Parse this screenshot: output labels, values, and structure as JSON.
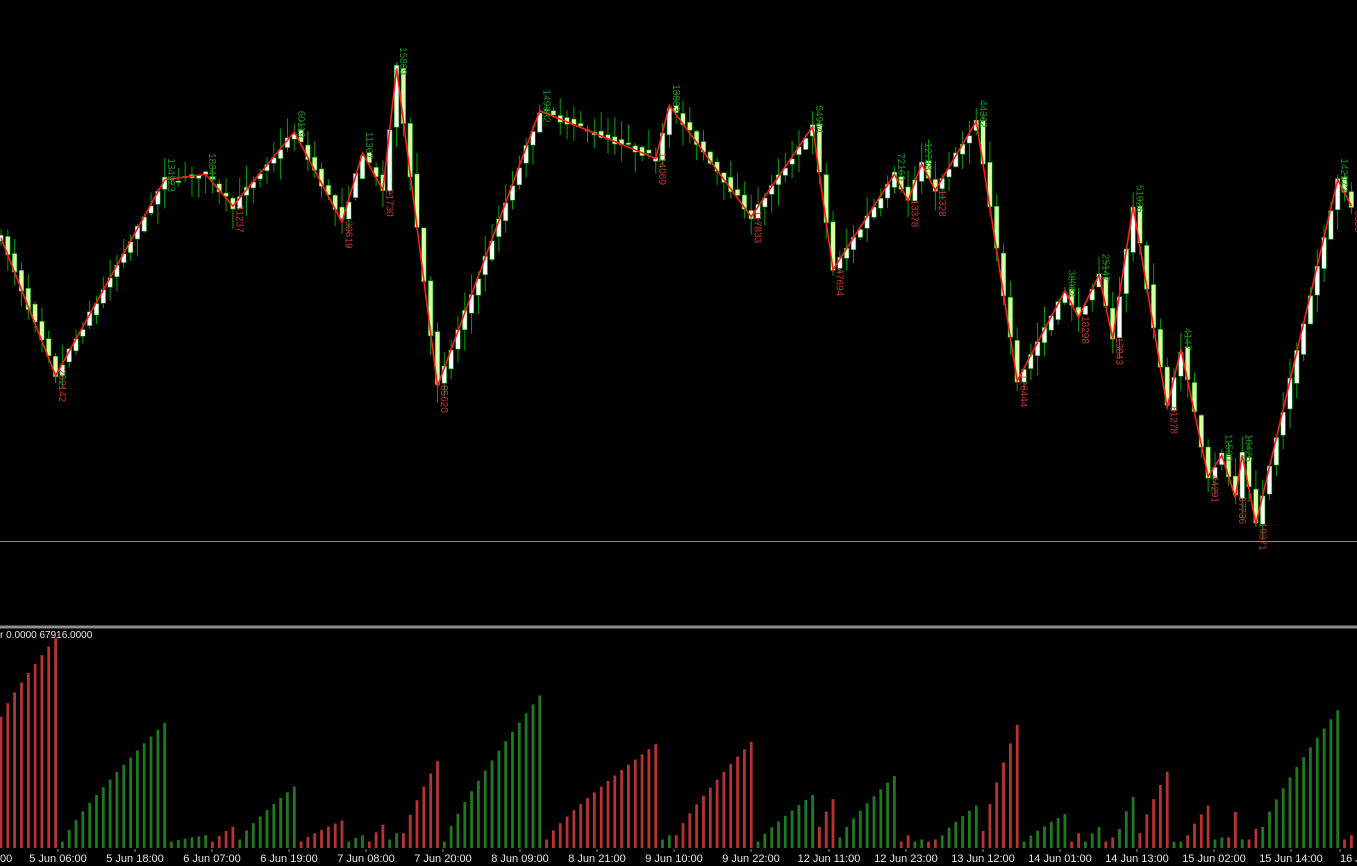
{
  "indicator": {
    "label": "r 0.0000 67916.0000"
  },
  "colors": {
    "background": "#000000",
    "wick": "#00a000",
    "bull_body": "#ffffff",
    "bear_body": "#d8ffa0",
    "zigzag": "#ff1a1a",
    "label_up": "#1f8f1f",
    "label_down": "#c83232",
    "hist_up": "#1e7a1e",
    "hist_down": "#b83232",
    "separator": "#8c8c8c",
    "time_text": "#e6e6e6"
  },
  "chart_data": [
    {
      "type": "candlestick",
      "subtype": "price with zigzag swing volume labels",
      "time_labels": [
        "00",
        "5 Jun 06:00",
        "5 Jun 18:00",
        "6 Jun 07:00",
        "6 Jun 19:00",
        "7 Jun 08:00",
        "7 Jun 20:00",
        "8 Jun 09:00",
        "8 Jun 21:00",
        "9 Jun 10:00",
        "9 Jun 22:00",
        "12 Jun 11:00",
        "12 Jun 23:00",
        "13 Jun 12:00",
        "14 Jun 01:00",
        "14 Jun 13:00",
        "15 Jun 02:00",
        "15 Jun 14:00",
        "16 J"
      ],
      "zigzag": [
        {
          "i": 0,
          "y": 57,
          "label": ""
        },
        {
          "i": 8,
          "y": 31,
          "label": "202142",
          "dir": "down"
        },
        {
          "i": 24,
          "y": 68,
          "label": "134923",
          "dir": "up"
        },
        {
          "i": 30,
          "y": 69,
          "label": "18348",
          "dir": "up"
        },
        {
          "i": 34,
          "y": 63,
          "label": "31237",
          "dir": "down"
        },
        {
          "i": 43,
          "y": 77,
          "label": "60119",
          "dir": "up"
        },
        {
          "i": 50,
          "y": 60,
          "label": "30619",
          "dir": "down"
        },
        {
          "i": 53,
          "y": 73,
          "label": "11307",
          "dir": "up"
        },
        {
          "i": 56,
          "y": 66,
          "label": "21730",
          "dir": "down"
        },
        {
          "i": 58,
          "y": 89,
          "label": "15889",
          "dir": "up"
        },
        {
          "i": 64,
          "y": 29,
          "label": "85620",
          "dir": "down"
        },
        {
          "i": 79,
          "y": 81,
          "label": "149382",
          "dir": "up"
        },
        {
          "i": 96,
          "y": 72,
          "label": "114069",
          "dir": "down"
        },
        {
          "i": 98,
          "y": 82,
          "label": "13883",
          "dir": "up"
        },
        {
          "i": 110,
          "y": 61,
          "label": "117833",
          "dir": "down"
        },
        {
          "i": 119,
          "y": 78,
          "label": "54964",
          "dir": "up"
        },
        {
          "i": 122,
          "y": 51,
          "label": "47694",
          "dir": "down"
        },
        {
          "i": 131,
          "y": 69,
          "label": "72160",
          "dir": "up"
        },
        {
          "i": 133,
          "y": 64,
          "label": "13378",
          "dir": "down"
        },
        {
          "i": 135,
          "y": 71,
          "label": "12738",
          "dir": "up"
        },
        {
          "i": 137,
          "y": 66,
          "label": "11328",
          "dir": "down"
        },
        {
          "i": 143,
          "y": 79,
          "label": "44362",
          "dir": "up"
        },
        {
          "i": 149,
          "y": 30,
          "label": "126444",
          "dir": "down"
        },
        {
          "i": 156,
          "y": 47,
          "label": "38084",
          "dir": "up"
        },
        {
          "i": 158,
          "y": 42,
          "label": "18298",
          "dir": "down"
        },
        {
          "i": 161,
          "y": 50,
          "label": "25147",
          "dir": "up"
        },
        {
          "i": 163,
          "y": 38,
          "label": "13843",
          "dir": "down"
        },
        {
          "i": 166,
          "y": 63,
          "label": "51026",
          "dir": "up"
        },
        {
          "i": 171,
          "y": 25,
          "label": "81278",
          "dir": "down"
        },
        {
          "i": 173,
          "y": 36,
          "label": "4147",
          "dir": "up"
        },
        {
          "i": 177,
          "y": 12,
          "label": "44291",
          "dir": "down"
        },
        {
          "i": 179,
          "y": 16,
          "label": "11560",
          "dir": "up"
        },
        {
          "i": 181,
          "y": 8,
          "label": "37736",
          "dir": "down"
        },
        {
          "i": 182,
          "y": 16,
          "label": "10426",
          "dir": "up"
        },
        {
          "i": 184,
          "y": 3,
          "label": "19371",
          "dir": "down"
        },
        {
          "i": 196,
          "y": 68,
          "label": "142972",
          "dir": "up"
        },
        {
          "i": 198,
          "y": 63,
          "label": "6380",
          "dir": "down"
        }
      ]
    },
    {
      "type": "bar",
      "subtype": "cumulative swing volume histogram",
      "ylim": [
        0,
        67916
      ],
      "segments": [
        {
          "dir": "down",
          "start": 0,
          "end": 8,
          "from": 0.62,
          "to": 0.99
        },
        {
          "dir": "up",
          "start": 9,
          "end": 24,
          "from": 0.03,
          "to": 0.59
        },
        {
          "dir": "up",
          "start": 25,
          "end": 30,
          "from": 0.03,
          "to": 0.06
        },
        {
          "dir": "down",
          "start": 31,
          "end": 34,
          "from": 0.03,
          "to": 0.1
        },
        {
          "dir": "up",
          "start": 35,
          "end": 43,
          "from": 0.04,
          "to": 0.29
        },
        {
          "dir": "down",
          "start": 44,
          "end": 50,
          "from": 0.03,
          "to": 0.13
        },
        {
          "dir": "up",
          "start": 51,
          "end": 53,
          "from": 0.03,
          "to": 0.06
        },
        {
          "dir": "down",
          "start": 54,
          "end": 56,
          "from": 0.03,
          "to": 0.11
        },
        {
          "dir": "up",
          "start": 57,
          "end": 58,
          "from": 0.04,
          "to": 0.07
        },
        {
          "dir": "down",
          "start": 59,
          "end": 64,
          "from": 0.07,
          "to": 0.41
        },
        {
          "dir": "up",
          "start": 65,
          "end": 79,
          "from": 0.03,
          "to": 0.72
        },
        {
          "dir": "down",
          "start": 80,
          "end": 96,
          "from": 0.04,
          "to": 0.49
        },
        {
          "dir": "up",
          "start": 97,
          "end": 98,
          "from": 0.04,
          "to": 0.06
        },
        {
          "dir": "down",
          "start": 99,
          "end": 110,
          "from": 0.06,
          "to": 0.5
        },
        {
          "dir": "up",
          "start": 111,
          "end": 119,
          "from": 0.03,
          "to": 0.25
        },
        {
          "dir": "down",
          "start": 120,
          "end": 122,
          "from": 0.1,
          "to": 0.23
        },
        {
          "dir": "up",
          "start": 123,
          "end": 131,
          "from": 0.05,
          "to": 0.34
        },
        {
          "dir": "down",
          "start": 132,
          "end": 133,
          "from": 0.03,
          "to": 0.06
        },
        {
          "dir": "up",
          "start": 134,
          "end": 135,
          "from": 0.03,
          "to": 0.04
        },
        {
          "dir": "down",
          "start": 136,
          "end": 137,
          "from": 0.03,
          "to": 0.04
        },
        {
          "dir": "up",
          "start": 138,
          "end": 143,
          "from": 0.06,
          "to": 0.2
        },
        {
          "dir": "down",
          "start": 144,
          "end": 149,
          "from": 0.08,
          "to": 0.58
        },
        {
          "dir": "up",
          "start": 150,
          "end": 156,
          "from": 0.03,
          "to": 0.16
        },
        {
          "dir": "down",
          "start": 157,
          "end": 158,
          "from": 0.03,
          "to": 0.07
        },
        {
          "dir": "up",
          "start": 159,
          "end": 161,
          "from": 0.03,
          "to": 0.1
        },
        {
          "dir": "down",
          "start": 162,
          "end": 163,
          "from": 0.03,
          "to": 0.05
        },
        {
          "dir": "up",
          "start": 164,
          "end": 166,
          "from": 0.09,
          "to": 0.24
        },
        {
          "dir": "down",
          "start": 167,
          "end": 171,
          "from": 0.07,
          "to": 0.36
        },
        {
          "dir": "up",
          "start": 172,
          "end": 173,
          "from": 0.03,
          "to": 0.03
        },
        {
          "dir": "down",
          "start": 174,
          "end": 177,
          "from": 0.06,
          "to": 0.2
        },
        {
          "dir": "up",
          "start": 178,
          "end": 179,
          "from": 0.04,
          "to": 0.05
        },
        {
          "dir": "down",
          "start": 180,
          "end": 181,
          "from": 0.05,
          "to": 0.17
        },
        {
          "dir": "up",
          "start": 182,
          "end": 182,
          "from": 0.04,
          "to": 0.04
        },
        {
          "dir": "down",
          "start": 183,
          "end": 184,
          "from": 0.04,
          "to": 0.09
        },
        {
          "dir": "up",
          "start": 185,
          "end": 196,
          "from": 0.1,
          "to": 0.65
        },
        {
          "dir": "down",
          "start": 197,
          "end": 198,
          "from": 0.04,
          "to": 0.06
        }
      ]
    }
  ]
}
